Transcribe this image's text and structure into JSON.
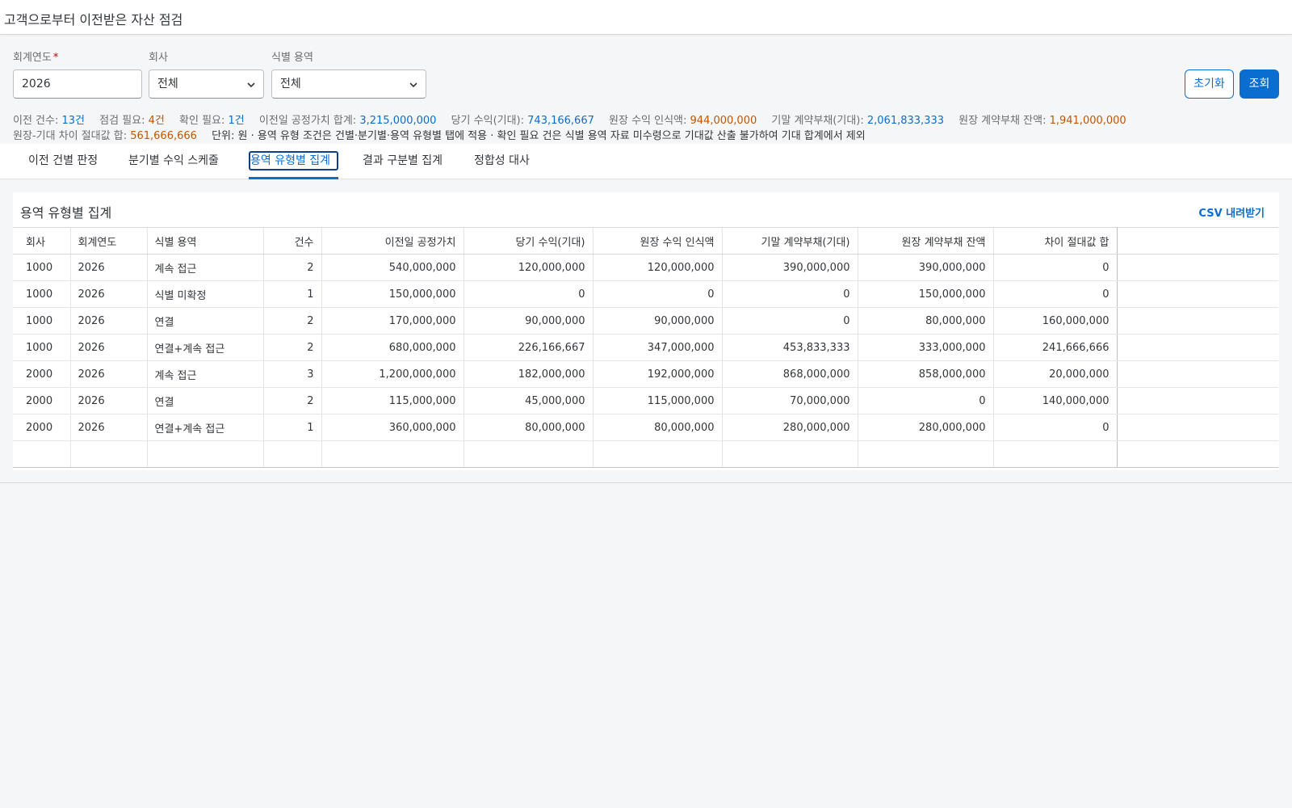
{
  "page": {
    "title": "고객으로부터 이전받은 자산 점검"
  },
  "filters": {
    "fiscal_year_label": "회계연도",
    "fiscal_year_required": "*",
    "fiscal_year_value": "2026",
    "company_label": "회사",
    "company_value": "전체",
    "service_label": "식별 용역",
    "service_value": "전체",
    "reset_label": "초기화",
    "search_label": "조회"
  },
  "summary": {
    "transfer_count_label": "이전 건수:",
    "transfer_count_value": "13건",
    "check_needed_label": "점검 필요:",
    "check_needed_value": "4건",
    "confirm_needed_label": "확인 필요:",
    "confirm_needed_value": "1건",
    "fair_value_label": "이전일 공정가치 합계:",
    "fair_value_value": "3,215,000,000",
    "revenue_expected_label": "당기 수익(기대):",
    "revenue_expected_value": "743,166,667",
    "ledger_revenue_label": "원장 수익 인식액:",
    "ledger_revenue_value": "944,000,000",
    "contract_liability_expected_label": "기말 계약부채(기대):",
    "contract_liability_expected_value": "2,061,833,333",
    "ledger_liability_label": "원장 계약부채 잔액:",
    "ledger_liability_value": "1,941,000,000",
    "abs_diff_label": "원장-기대 차이 절대값 합:",
    "abs_diff_value": "561,666,666",
    "note": "단위: 원 · 용역 유형 조건은 건별·분기별·용역 유형별 탭에 적용 · 확인 필요 건은 식별 용역 자료 미수령으로 기대값 산출 불가하여 기대 합계에서 제외"
  },
  "tabs": [
    {
      "label": "이전 건별 판정"
    },
    {
      "label": "분기별 수익 스케줄"
    },
    {
      "label": "용역 유형별 집계"
    },
    {
      "label": "결과 구분별 집계"
    },
    {
      "label": "정합성 대사"
    }
  ],
  "active_tab": "용역 유형별 집계",
  "panel": {
    "title": "용역 유형별 집계",
    "csv_label": "CSV 내려받기"
  },
  "table": {
    "columns": [
      "회사",
      "회계연도",
      "식별 용역",
      "건수",
      "이전일 공정가치",
      "당기 수익(기대)",
      "원장 수익 인식액",
      "기말 계약부채(기대)",
      "원장 계약부채 잔액",
      "차이 절대값 합"
    ],
    "rows": [
      [
        "1000",
        "2026",
        "계속 접근",
        "2",
        "540,000,000",
        "120,000,000",
        "120,000,000",
        "390,000,000",
        "390,000,000",
        "0"
      ],
      [
        "1000",
        "2026",
        "식별 미확정",
        "1",
        "150,000,000",
        "0",
        "0",
        "0",
        "150,000,000",
        "0"
      ],
      [
        "1000",
        "2026",
        "연결",
        "2",
        "170,000,000",
        "90,000,000",
        "90,000,000",
        "0",
        "80,000,000",
        "160,000,000"
      ],
      [
        "1000",
        "2026",
        "연결+계속 접근",
        "2",
        "680,000,000",
        "226,166,667",
        "347,000,000",
        "453,833,333",
        "333,000,000",
        "241,666,666"
      ],
      [
        "2000",
        "2026",
        "계속 접근",
        "3",
        "1,200,000,000",
        "182,000,000",
        "192,000,000",
        "868,000,000",
        "858,000,000",
        "20,000,000"
      ],
      [
        "2000",
        "2026",
        "연결",
        "2",
        "115,000,000",
        "45,000,000",
        "115,000,000",
        "70,000,000",
        "0",
        "140,000,000"
      ],
      [
        "2000",
        "2026",
        "연결+계속 접근",
        "1",
        "360,000,000",
        "80,000,000",
        "80,000,000",
        "280,000,000",
        "280,000,000",
        "0"
      ]
    ]
  },
  "colors": {
    "accent": "#0a6ed1",
    "warning": "#c35500",
    "required": "#bb0000"
  }
}
